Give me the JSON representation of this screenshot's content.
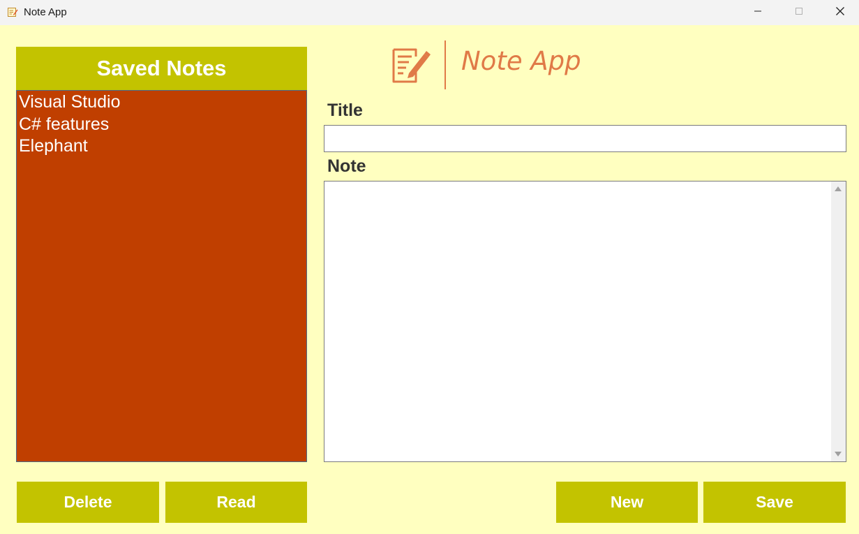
{
  "window": {
    "title": "Note App",
    "app_icon": "notepad-icon",
    "controls": [
      "minimize-icon",
      "maximize-icon",
      "close-icon"
    ]
  },
  "sidebar": {
    "header": "Saved Notes",
    "items": [
      {
        "label": "Visual Studio"
      },
      {
        "label": "C# features"
      },
      {
        "label": "Elephant"
      }
    ],
    "buttons": {
      "delete_label": "Delete",
      "read_label": "Read"
    }
  },
  "logo": {
    "icon": "note-edit-icon",
    "text": "Note App"
  },
  "form": {
    "title_label": "Title",
    "title_value": "",
    "note_label": "Note",
    "note_value": "",
    "buttons": {
      "new_label": "New",
      "save_label": "Save"
    }
  },
  "colors": {
    "background": "#FFFFC0",
    "accent": "#C3C300",
    "list_background": "#C03F00",
    "logo": "#E07A47",
    "button_text": "#FFFFFF"
  }
}
